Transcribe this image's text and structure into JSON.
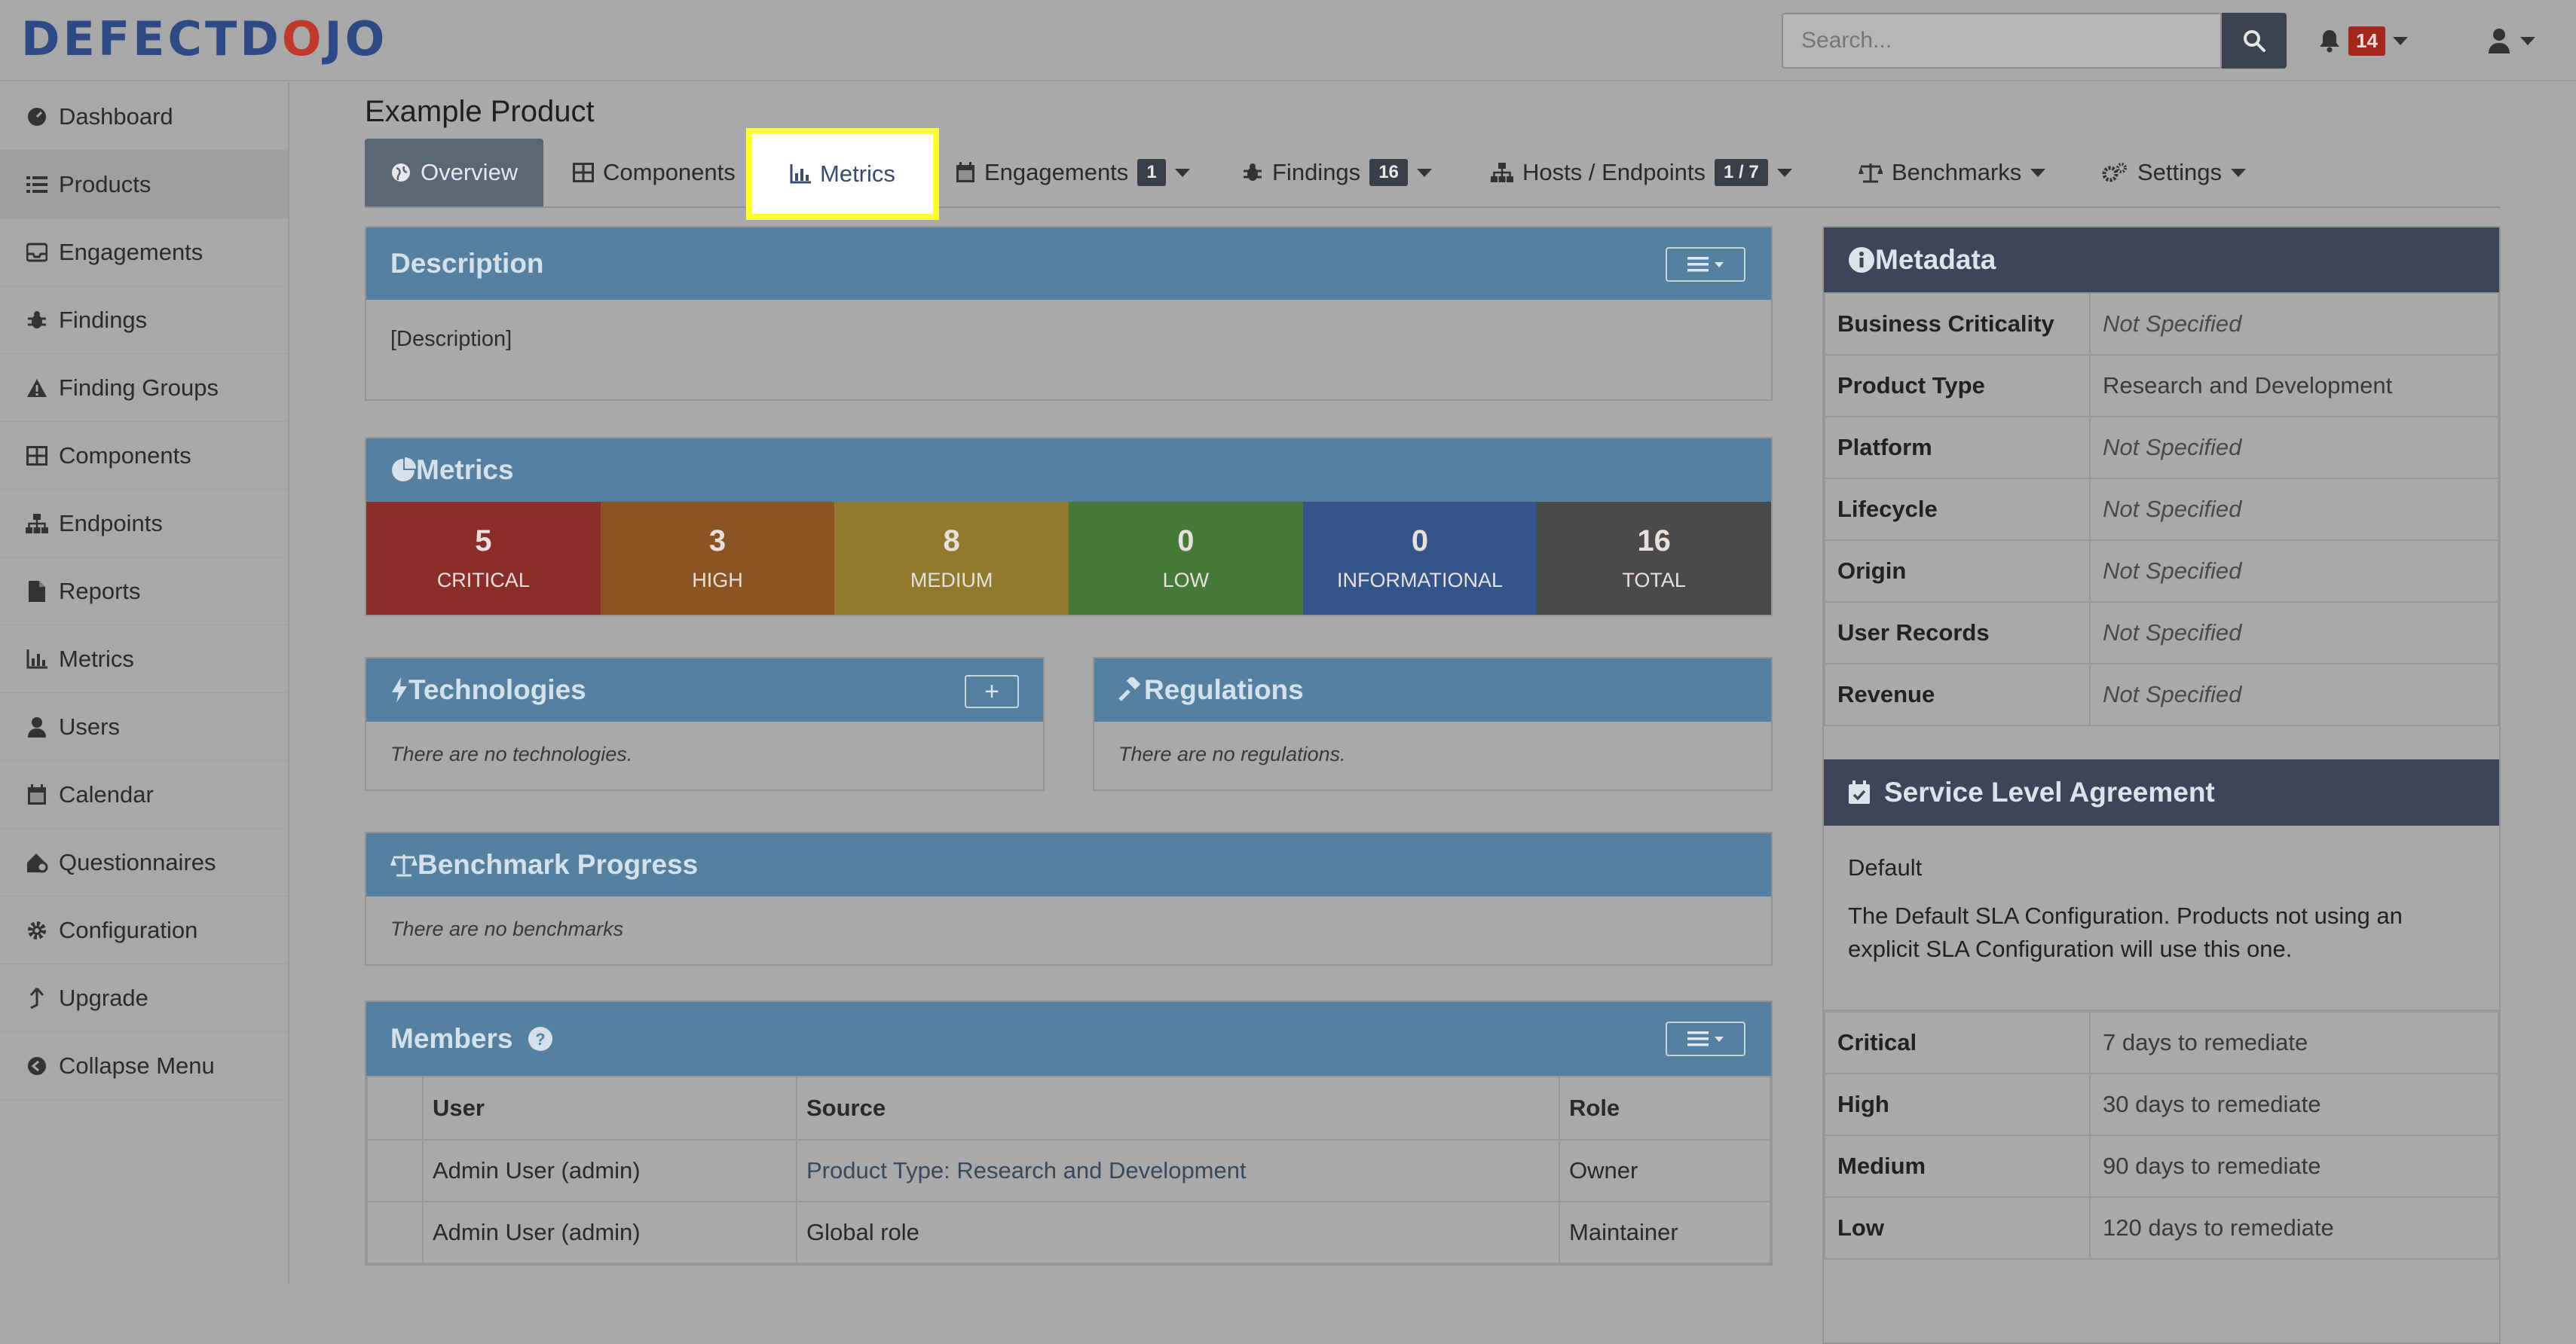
{
  "brand": {
    "logo_text_a": "DEFECTD",
    "logo_text_b": "O",
    "logo_text_c": "JO"
  },
  "search": {
    "placeholder": "Search..."
  },
  "alerts": {
    "count": "14"
  },
  "sidebar": {
    "items": [
      {
        "label": "Dashboard",
        "icon": "dashboard-icon"
      },
      {
        "label": "Products",
        "icon": "list-icon"
      },
      {
        "label": "Engagements",
        "icon": "inbox-icon"
      },
      {
        "label": "Findings",
        "icon": "bug-icon"
      },
      {
        "label": "Finding Groups",
        "icon": "warning-icon"
      },
      {
        "label": "Components",
        "icon": "table-icon"
      },
      {
        "label": "Endpoints",
        "icon": "sitemap-icon"
      },
      {
        "label": "Reports",
        "icon": "file-icon"
      },
      {
        "label": "Metrics",
        "icon": "chart-icon"
      },
      {
        "label": "Users",
        "icon": "user-icon"
      },
      {
        "label": "Calendar",
        "icon": "calendar-icon"
      },
      {
        "label": "Questionnaires",
        "icon": "questionnaire-icon"
      },
      {
        "label": "Configuration",
        "icon": "gear-icon"
      },
      {
        "label": "Upgrade",
        "icon": "upgrade-icon"
      },
      {
        "label": "Collapse Menu",
        "icon": "collapse-icon"
      }
    ]
  },
  "page": {
    "title": "Example Product"
  },
  "tabs": {
    "overview": "Overview",
    "components": "Components",
    "metrics": "Metrics",
    "engagements": "Engagements",
    "engagements_count": "1",
    "findings": "Findings",
    "findings_count": "16",
    "hosts": "Hosts / Endpoints",
    "hosts_count": "1 / 7",
    "benchmarks": "Benchmarks",
    "settings": "Settings"
  },
  "description": {
    "title": "Description",
    "body": "[Description]"
  },
  "metrics": {
    "title": "Metrics",
    "severities": [
      {
        "count": "5",
        "label": "CRITICAL",
        "color": "#8b2e2a"
      },
      {
        "count": "3",
        "label": "HIGH",
        "color": "#8a5423"
      },
      {
        "count": "8",
        "label": "MEDIUM",
        "color": "#917a2e"
      },
      {
        "count": "0",
        "label": "LOW",
        "color": "#467a3b"
      },
      {
        "count": "0",
        "label": "INFORMATIONAL",
        "color": "#33558a"
      },
      {
        "count": "16",
        "label": "TOTAL",
        "color": "#4a4a4a"
      }
    ]
  },
  "technologies": {
    "title": "Technologies",
    "empty": "There are no technologies."
  },
  "regulations": {
    "title": "Regulations",
    "empty": "There are no regulations."
  },
  "benchmark": {
    "title": "Benchmark Progress",
    "empty": "There are no benchmarks"
  },
  "members": {
    "title": "Members",
    "columns": [
      "User",
      "Source",
      "Role"
    ],
    "rows": [
      {
        "user": "Admin User (admin)",
        "source": "Product Type: Research and Development",
        "role": "Owner"
      },
      {
        "user": "Admin User (admin)",
        "source": "Global role",
        "role": "Maintainer"
      }
    ]
  },
  "metadata": {
    "title": "Metadata",
    "rows": [
      {
        "key": "Business Criticality",
        "value": "Not Specified"
      },
      {
        "key": "Product Type",
        "value": "Research and Development"
      },
      {
        "key": "Platform",
        "value": "Not Specified"
      },
      {
        "key": "Lifecycle",
        "value": "Not Specified"
      },
      {
        "key": "Origin",
        "value": "Not Specified"
      },
      {
        "key": "User Records",
        "value": "Not Specified"
      },
      {
        "key": "Revenue",
        "value": "Not Specified"
      }
    ]
  },
  "sla": {
    "title": "Service Level Agreement",
    "name": "Default",
    "description": "The Default SLA Configuration. Products not using an explicit SLA Configuration will use this one.",
    "rows": [
      {
        "key": "Critical",
        "value": "7 days to remediate"
      },
      {
        "key": "High",
        "value": "30 days to remediate"
      },
      {
        "key": "Medium",
        "value": "90 days to remediate"
      },
      {
        "key": "Low",
        "value": "120 days to remediate"
      }
    ]
  },
  "colors": {
    "panel_header": "#55809f",
    "dark_header": "#3c4658",
    "highlight": "#ffff33"
  }
}
